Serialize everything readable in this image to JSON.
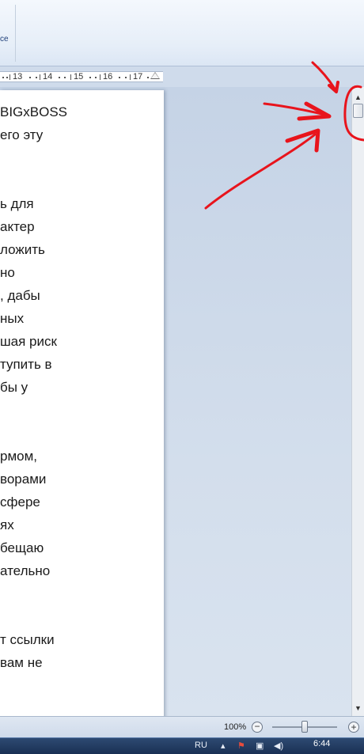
{
  "ribbon": {
    "partial_label": "ce"
  },
  "ruler": {
    "marks": [
      "13",
      "14",
      "15",
      "16",
      "17"
    ]
  },
  "document": {
    "lines": [
      "BIGxBOSS",
      "его эту",
      "",
      "",
      "ь для",
      "актер",
      "ложить",
      "но",
      ", дабы",
      "ных",
      "шая риск",
      "тупить в",
      "бы у",
      "",
      "",
      "рмом,",
      "ворами",
      "сфере",
      "ях",
      "бещаю",
      "ательно",
      "",
      "",
      "т ссылки",
      "вам не"
    ]
  },
  "scrollbar": {
    "up_glyph": "▲",
    "down_glyph": "▼"
  },
  "statusbar": {
    "zoom": "100%",
    "zoom_out_glyph": "−",
    "zoom_in_glyph": "+"
  },
  "taskbar": {
    "language": "RU",
    "time": "6:44",
    "icons": [
      "show-hidden-icon",
      "flag-icon",
      "network-icon",
      "volume-icon"
    ]
  },
  "annotation": {
    "color": "#e8141c"
  }
}
